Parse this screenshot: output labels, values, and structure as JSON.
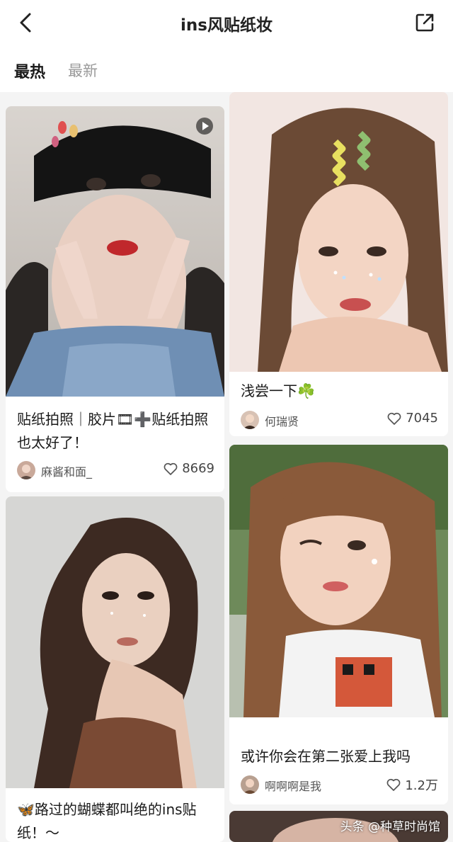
{
  "header": {
    "title": "ins风贴纸妆",
    "back_icon": "chevron-left-icon",
    "share_icon": "share-icon"
  },
  "tabs": [
    {
      "label": "最热",
      "active": true
    },
    {
      "label": "最新",
      "active": false
    }
  ],
  "cards": [
    {
      "title": "贴纸拍照｜胶片🎞➕贴纸拍照也太好了！",
      "author": "麻酱和面_",
      "likes": "8669",
      "is_video": true
    },
    {
      "title": "浅尝一下☘️",
      "author": "何瑞贤",
      "likes": "7045",
      "is_video": false
    },
    {
      "title": "或许你会在第二张爱上我吗",
      "author": "啊啊啊是我",
      "likes": "1.2万",
      "is_video": false
    },
    {
      "title": "🦋路过的蝴蝶都叫绝的ins贴纸！～",
      "author": "",
      "likes": "",
      "is_video": false
    }
  ],
  "watermark": "头条 @种草时尚馆",
  "colors": {
    "background": "#f4f4f4",
    "card": "#ffffff",
    "muted_text": "#9a9a9a"
  }
}
